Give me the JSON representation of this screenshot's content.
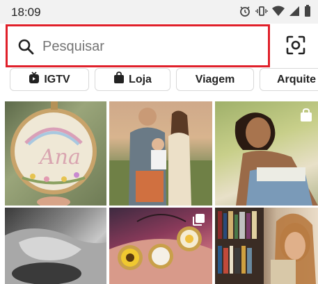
{
  "status_bar": {
    "time": "18:09",
    "icons": [
      "alarm-icon",
      "vibrate-icon",
      "wifi-icon",
      "signal-icon",
      "battery-icon"
    ]
  },
  "search": {
    "placeholder": "Pesquisar",
    "value": "",
    "highlight_color": "#e0202a"
  },
  "chips": [
    {
      "label": "IGTV",
      "icon": "igtv-icon"
    },
    {
      "label": "Loja",
      "icon": "shopping-bag-icon"
    },
    {
      "label": "Viagem",
      "icon": ""
    },
    {
      "label": "Arquite",
      "icon": ""
    }
  ],
  "grid": {
    "tiles": [
      {
        "subject": "embroidery-hoop-ana",
        "embroidery_text": "Ana"
      },
      {
        "subject": "couple-with-baby"
      },
      {
        "subject": "woman-portrait",
        "badge": "shopping-bag-icon"
      },
      {
        "subject": "hands-black-white"
      },
      {
        "subject": "embroidery-keychains",
        "badge": "multi-post-icon"
      },
      {
        "subject": "woman-with-bookshelf"
      }
    ]
  }
}
